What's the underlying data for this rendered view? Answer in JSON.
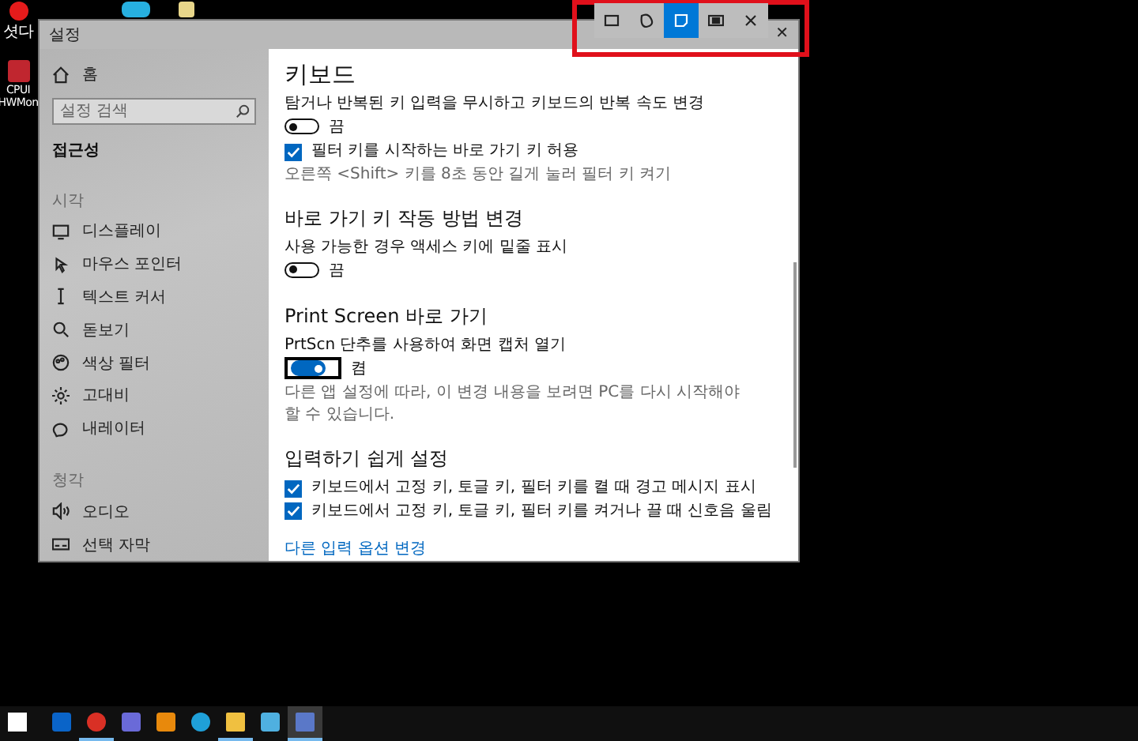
{
  "desktop_icons": [
    {
      "label": "셧다"
    },
    {
      "label": "CPUI HWMon"
    }
  ],
  "window": {
    "title": "설정",
    "close_glyph": "✕"
  },
  "sidebar": {
    "home": "홈",
    "search": {
      "placeholder": "설정 검색"
    },
    "title": "접근성",
    "groups": [
      {
        "title": "시각",
        "items": [
          {
            "label": "디스플레이"
          },
          {
            "label": "마우스 포인터"
          },
          {
            "label": "텍스트 커서"
          },
          {
            "label": "돋보기"
          },
          {
            "label": "색상 필터"
          },
          {
            "label": "고대비"
          },
          {
            "label": "내레이터"
          }
        ]
      },
      {
        "title": "청각",
        "items": [
          {
            "label": "오디오"
          },
          {
            "label": "선택 자막"
          }
        ]
      }
    ]
  },
  "content": {
    "title": "키보드",
    "sections": [
      {
        "settings": [
          {
            "kind": "toggle",
            "label": "탐거나 반복된 키 입력을 무시하고 키보드의 반복 속도 변경",
            "on": false,
            "focused": false,
            "state_text": "끔"
          },
          {
            "kind": "checkbox",
            "label": "필터 키를 시작하는 바로 가기 키 허용",
            "checked": true
          },
          {
            "kind": "hint",
            "text": "오른쪽 <Shift> 키를 8초 동안 길게 눌러 필터 키 켜기"
          }
        ]
      },
      {
        "heading": "바로 가기 키 작동 방법 변경",
        "settings": [
          {
            "kind": "toggle",
            "label": "사용 가능한 경우 액세스 키에 밑줄 표시",
            "on": false,
            "focused": false,
            "state_text": "끔"
          }
        ]
      },
      {
        "heading": "Print Screen 바로 가기",
        "settings": [
          {
            "kind": "toggle",
            "label": "PrtScn 단추를 사용하여 화면 캡처 열기",
            "on": true,
            "focused": true,
            "state_text": "켬"
          },
          {
            "kind": "hint",
            "text": "다른 앱 설정에 따라, 이 변경 내용을 보려면 PC를 다시 시작해야 할 수 있습니다."
          }
        ]
      },
      {
        "heading": "입력하기 쉽게 설정",
        "settings": [
          {
            "kind": "checkbox",
            "label": "키보드에서 고정 키, 토글 키, 필터 키를 켤 때 경고 메시지 표시",
            "checked": true
          },
          {
            "kind": "checkbox",
            "label": "키보드에서 고정 키, 토글 키, 필터 키를 켜거나 끌 때 신호음 울림",
            "checked": true
          },
          {
            "kind": "link",
            "text": "다른 입력 옵션 변경"
          }
        ]
      }
    ]
  },
  "snip_toolbar": {
    "buttons": [
      {
        "selected": false
      },
      {
        "selected": false
      },
      {
        "selected": true
      },
      {
        "selected": false
      },
      {
        "selected": false
      }
    ]
  },
  "taskbar": {
    "apps": [
      {
        "running": false,
        "selected": false
      },
      {
        "running": false,
        "selected": false
      },
      {
        "running": true,
        "selected": false
      },
      {
        "running": false,
        "selected": false
      },
      {
        "running": false,
        "selected": false
      },
      {
        "running": false,
        "selected": false
      },
      {
        "running": true,
        "selected": false
      },
      {
        "running": false,
        "selected": false
      },
      {
        "running": true,
        "selected": true
      }
    ]
  }
}
